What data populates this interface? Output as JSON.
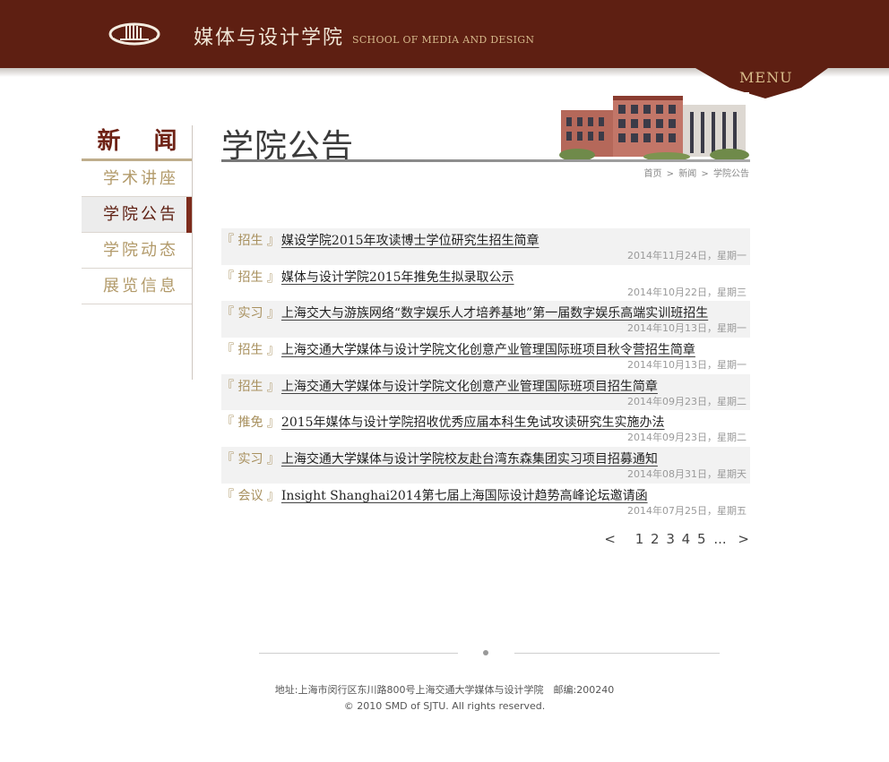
{
  "header": {
    "school_cn": "媒体与设计学院",
    "school_en": "SCHOOL OF MEDIA AND DESIGN",
    "menu_label": "MENU",
    "logo_icon": "building-logo-icon",
    "colors": {
      "brand": "#5e1f12",
      "gold": "#d4b78a"
    }
  },
  "sidebar": {
    "title": "新 闻",
    "items": [
      {
        "label": "学术讲座",
        "active": false
      },
      {
        "label": "学院公告",
        "active": true
      },
      {
        "label": "学院动态",
        "active": false
      },
      {
        "label": "展览信息",
        "active": false
      }
    ]
  },
  "main": {
    "page_title": "学院公告",
    "breadcrumb": [
      "首页",
      ">",
      "新闻",
      ">",
      "学院公告"
    ],
    "news": [
      {
        "tag": "『 招生 』",
        "title": "媒设学院2015年攻读博士学位研究生招生简章",
        "date": "2014年11月24日，星期一"
      },
      {
        "tag": "『 招生 』",
        "title": "媒体与设计学院2015年推免生拟录取公示",
        "date": "2014年10月22日，星期三"
      },
      {
        "tag": "『 实习 』",
        "title": "上海交大与游族网络“数字娱乐人才培养基地”第一届数字娱乐高端实训班招生",
        "date": "2014年10月13日，星期一"
      },
      {
        "tag": "『 招生 』",
        "title": "上海交通大学媒体与设计学院文化创意产业管理国际班项目秋令营招生简章",
        "date": "2014年10月13日，星期一"
      },
      {
        "tag": "『 招生 』",
        "title": "上海交通大学媒体与设计学院文化创意产业管理国际班项目招生简章",
        "date": "2014年09月23日，星期二"
      },
      {
        "tag": "『 推免 』",
        "title": "2015年媒体与设计学院招收优秀应届本科生免试攻读研究生实施办法",
        "date": "2014年09月23日，星期二"
      },
      {
        "tag": "『 实习 』",
        "title": "上海交通大学媒体与设计学院校友赴台湾东森集团实习项目招募通知",
        "date": "2014年08月31日，星期天"
      },
      {
        "tag": "『 会议 』",
        "title": "Insight Shanghai2014第七届上海国际设计趋势高峰论坛邀请函",
        "date": "2014年07月25日，星期五"
      }
    ],
    "pager": {
      "prev": "<",
      "pages": [
        "1",
        "2",
        "3",
        "4",
        "5"
      ],
      "dots": "...",
      "next": ">"
    }
  },
  "footer": {
    "address": "地址:上海市闵行区东川路800号上海交通大学媒体与设计学院　邮编:200240",
    "copyright": "© 2010 SMD of SJTU. All rights reserved."
  }
}
